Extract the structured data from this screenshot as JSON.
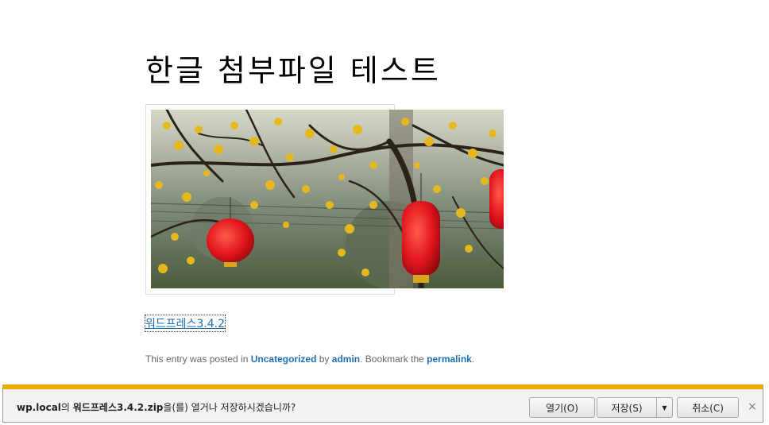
{
  "post": {
    "title": "한글 첨부파일 테스트",
    "attachment_link": "워드프레스3.4.2",
    "meta": {
      "prefix": "This entry was posted in ",
      "category": "Uncategorized",
      "by": " by ",
      "author": "admin",
      "bookmark": ". Bookmark the ",
      "permalink": "permalink",
      "suffix": "."
    }
  },
  "download_bar": {
    "site": "wp.local",
    "of": "의 ",
    "filename": "워드프레스3.4.2.zip",
    "question": "을(를) 열거나 저장하시겠습니까?",
    "open_label": "열기(O)",
    "save_label": "저장(S)",
    "save_arrow": "▼",
    "cancel_label": "취소(C)",
    "close_glyph": "×"
  },
  "colors": {
    "link": "#1e6fb0",
    "notif_accent": "#f0ab00"
  }
}
